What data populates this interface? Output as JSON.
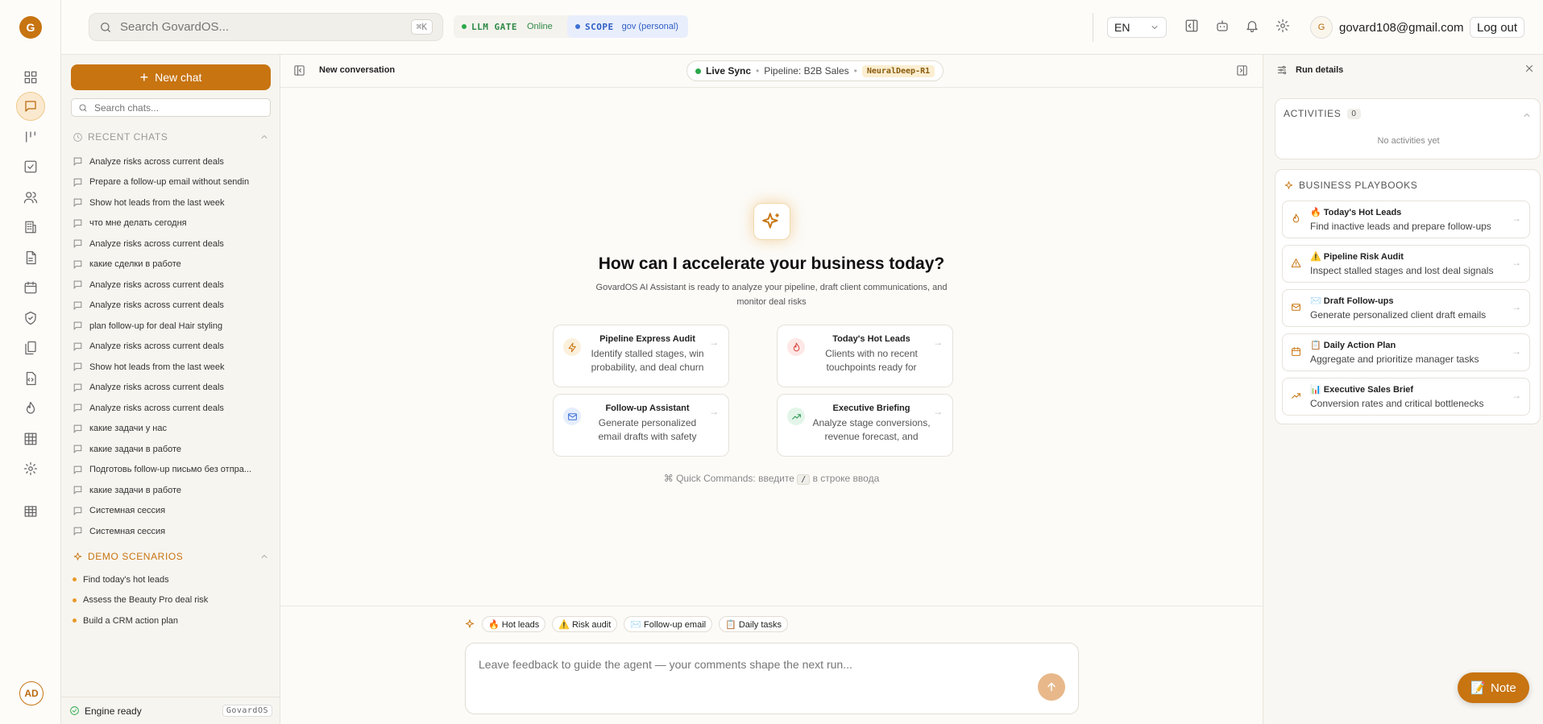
{
  "app": {
    "logo_letter": "G",
    "brand_color": "#c77411"
  },
  "header": {
    "search_placeholder": "Search GovardOS...",
    "search_shortcut": "⌘K",
    "llm_gate_label": "LLM GATE",
    "llm_gate_status": "Online",
    "scope_label": "SCOPE",
    "scope_value": "gov (personal)",
    "language": "EN",
    "user_initial": "G",
    "user_email": "govard108@gmail.com",
    "logout_label": "Log out"
  },
  "rail": {
    "items": [
      "dashboard-icon",
      "chat-icon",
      "pipeline-icon",
      "tasks-icon",
      "contacts-icon",
      "companies-icon",
      "documents-icon",
      "calendar-icon",
      "security-icon",
      "files-icon",
      "code-icon",
      "hot-icon",
      "grid-icon",
      "settings-icon",
      "table-icon"
    ],
    "user_initials": "AD"
  },
  "sidebar": {
    "new_chat_label": "New chat",
    "search_placeholder": "Search chats...",
    "recent_title": "RECENT CHATS",
    "recent_chats": [
      "Analyze risks across current deals",
      "Prepare a follow-up email without sendin",
      "Show hot leads from the last week",
      "что мне делать сегодня",
      "Analyze risks across current deals",
      "какие сделки в работе",
      "Analyze risks across current deals",
      "Analyze risks across current deals",
      "plan follow-up for deal Hair styling",
      "Analyze risks across current deals",
      "Show hot leads from the last week",
      "Analyze risks across current deals",
      "Analyze risks across current deals",
      "какие задачи у нас",
      "какие задачи в работе",
      "Подготовь follow-up письмо без отпра...",
      "какие задачи в работе",
      "Системная сессия",
      "Системная сессия"
    ],
    "demo_title": "DEMO SCENARIOS",
    "demo_items": [
      "Find today's hot leads",
      "Assess the Beauty Pro deal risk",
      "Build a CRM action plan"
    ],
    "footer_status": "Engine ready",
    "footer_tag": "GovardOS"
  },
  "main": {
    "conversation_title": "New conversation",
    "live_label": "Live Sync",
    "pipeline_label": "Pipeline: B2B Sales",
    "model_name": "NeuralDeep-R1",
    "hero_title": "How can I accelerate your business today?",
    "hero_subtitle": "GovardOS AI Assistant is ready to analyze your pipeline, draft client communications, and monitor deal risks",
    "cards": [
      {
        "title": "Pipeline Express Audit",
        "desc": "Identify stalled stages, win probability, and deal churn risks",
        "icon": "bolt-icon",
        "color": "#c77411",
        "bg": "#fbf0dc"
      },
      {
        "title": "Today's Hot Leads",
        "desc": "Clients with no recent touchpoints ready for conversion",
        "icon": "flame-icon",
        "color": "#d9473f",
        "bg": "#fde8e6"
      },
      {
        "title": "Follow-up Assistant",
        "desc": "Generate personalized email drafts with safety confirmation",
        "icon": "mail-icon",
        "color": "#3b6fd6",
        "bg": "#e6eefc"
      },
      {
        "title": "Executive Briefing",
        "desc": "Analyze stage conversions, revenue forecast, and manager performance",
        "icon": "trend-icon",
        "color": "#2e9a55",
        "bg": "#e3f5e9"
      }
    ],
    "quick_prefix": "⌘ Quick Commands: введите",
    "quick_key": "/",
    "quick_suffix": "в строке ввода",
    "chips": [
      "🔥 Hot leads",
      "⚠️ Risk audit",
      "✉️ Follow-up email",
      "📋 Daily tasks"
    ],
    "composer_placeholder": "Leave feedback to guide the agent — your comments shape the next run..."
  },
  "run_panel": {
    "title": "Run details",
    "activities_title": "ACTIVITIES",
    "activities_count": "0",
    "activities_empty": "No activities yet",
    "playbooks_title": "BUSINESS PLAYBOOKS",
    "playbooks": [
      {
        "title": "🔥 Today's Hot Leads",
        "desc": "Find inactive leads and prepare follow-ups",
        "icon": "flame-icon"
      },
      {
        "title": "⚠️ Pipeline Risk Audit",
        "desc": "Inspect stalled stages and lost deal signals",
        "icon": "warning-icon"
      },
      {
        "title": "✉️ Draft Follow-ups",
        "desc": "Generate personalized client draft emails",
        "icon": "mail-icon"
      },
      {
        "title": "📋 Daily Action Plan",
        "desc": "Aggregate and prioritize manager tasks",
        "icon": "calendar-icon"
      },
      {
        "title": "📊 Executive Sales Brief",
        "desc": "Conversion rates and critical bottlenecks",
        "icon": "trend-icon"
      }
    ]
  },
  "note_label": "Note"
}
